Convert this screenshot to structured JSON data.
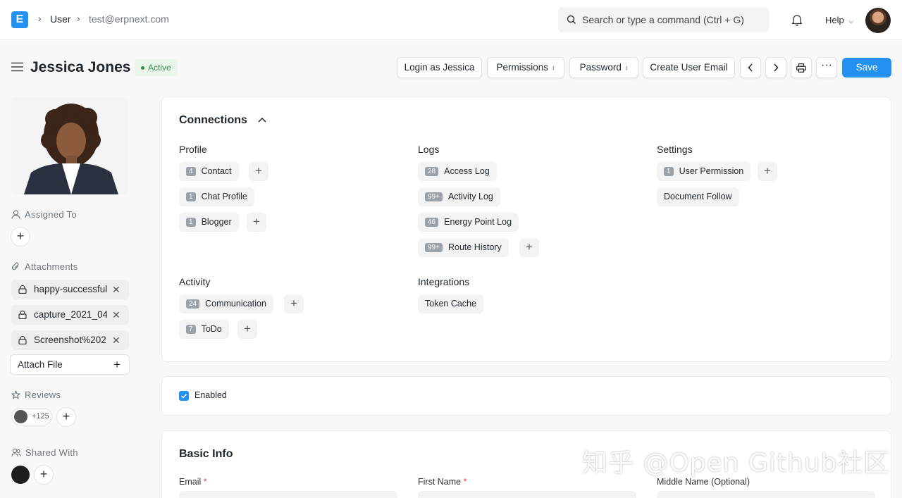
{
  "navbar": {
    "logo_letter": "E",
    "breadcrumbs": [
      "User",
      "test@erpnext.com"
    ],
    "search_placeholder": "Search or type a command (Ctrl + G)",
    "help_label": "Help"
  },
  "page": {
    "title": "Jessica Jones",
    "status": "Active",
    "actions": {
      "login_as": "Login as Jessica",
      "permissions": "Permissions",
      "password": "Password",
      "create_user_email": "Create User Email",
      "save": "Save"
    }
  },
  "sidebar": {
    "assigned_to_label": "Assigned To",
    "attachments_label": "Attachments",
    "attachments": [
      "happy-successful",
      "capture_2021_04",
      "Screenshot%202"
    ],
    "attach_file_label": "Attach File",
    "reviews_label": "Reviews",
    "reviews_count": "+125",
    "shared_with_label": "Shared With"
  },
  "connections": {
    "title": "Connections",
    "groups": {
      "profile": {
        "title": "Profile",
        "items": [
          {
            "label": "Contact",
            "count": "4"
          },
          {
            "label": "Chat Profile",
            "count": "1"
          },
          {
            "label": "Blogger",
            "count": "1"
          }
        ]
      },
      "logs": {
        "title": "Logs",
        "items": [
          {
            "label": "Access Log",
            "count": "28"
          },
          {
            "label": "Activity Log",
            "count": "99+"
          },
          {
            "label": "Energy Point Log",
            "count": "46"
          },
          {
            "label": "Route History",
            "count": "99+"
          }
        ]
      },
      "settings": {
        "title": "Settings",
        "items": [
          {
            "label": "User Permission",
            "count": "1"
          },
          {
            "label": "Document Follow",
            "count": ""
          }
        ]
      },
      "activity": {
        "title": "Activity",
        "items": [
          {
            "label": "Communication",
            "count": "24"
          },
          {
            "label": "ToDo",
            "count": "7"
          }
        ]
      },
      "integrations": {
        "title": "Integrations",
        "items": [
          {
            "label": "Token Cache",
            "count": ""
          }
        ]
      }
    }
  },
  "enabled": {
    "label": "Enabled",
    "checked": true
  },
  "basic_info": {
    "title": "Basic Info",
    "fields": {
      "email": "Email",
      "first_name": "First Name",
      "middle_name": "Middle Name (Optional)"
    }
  },
  "watermark": "知乎 @Open Github社区",
  "colors": {
    "primary": "#2490ef",
    "status_green": "#3c8b4e",
    "required": "#e24c4c"
  }
}
